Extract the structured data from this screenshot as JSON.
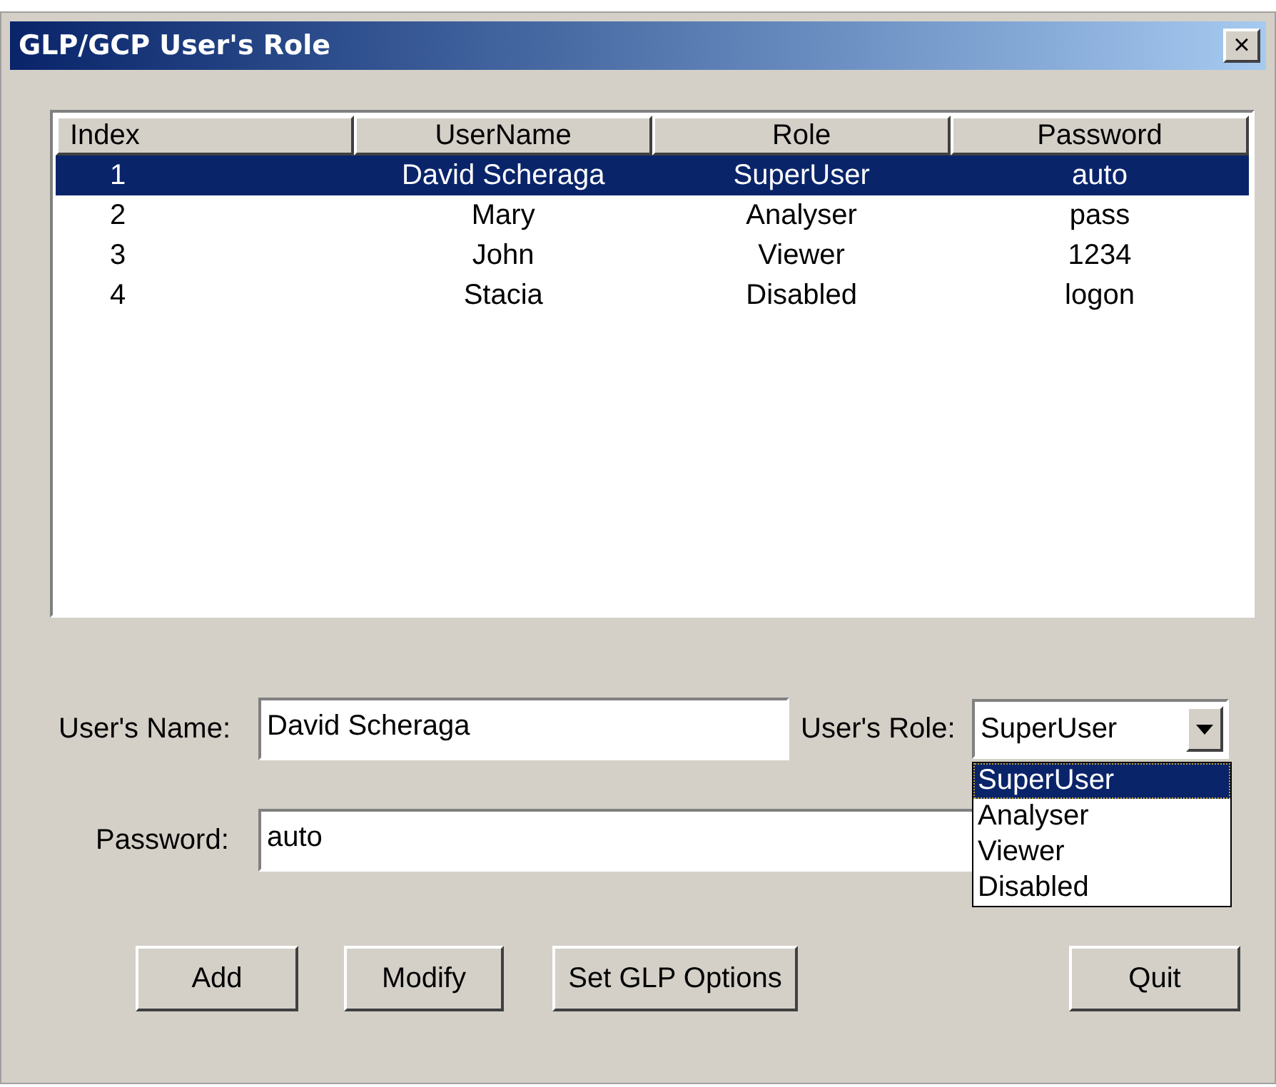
{
  "window": {
    "title": "GLP/GCP User's Role",
    "close": "×"
  },
  "table": {
    "columns": [
      "Index",
      "UserName",
      "Role",
      "Password"
    ],
    "rows": [
      {
        "cells": [
          "1",
          "David Scheraga",
          "SuperUser",
          "auto"
        ],
        "selected": true
      },
      {
        "cells": [
          "2",
          "Mary",
          "Analyser",
          "pass"
        ],
        "selected": false
      },
      {
        "cells": [
          "3",
          "John",
          "Viewer",
          "1234"
        ],
        "selected": false
      },
      {
        "cells": [
          "4",
          "Stacia",
          "Disabled",
          "logon"
        ],
        "selected": false
      }
    ]
  },
  "form": {
    "name_label": "User's Name:",
    "name_value": "David Scheraga",
    "role_label": "User's Role:",
    "role_value": "SuperUser",
    "password_label": "Password:",
    "password_value": "auto",
    "role_options": [
      {
        "label": "SuperUser",
        "selected": true
      },
      {
        "label": "Analyser",
        "selected": false
      },
      {
        "label": "Viewer",
        "selected": false
      },
      {
        "label": "Disabled",
        "selected": false
      }
    ]
  },
  "buttons": [
    {
      "label": "Add"
    },
    {
      "label": "Modify"
    },
    {
      "label": "Set GLP Options"
    },
    {
      "label": "Quit"
    }
  ]
}
